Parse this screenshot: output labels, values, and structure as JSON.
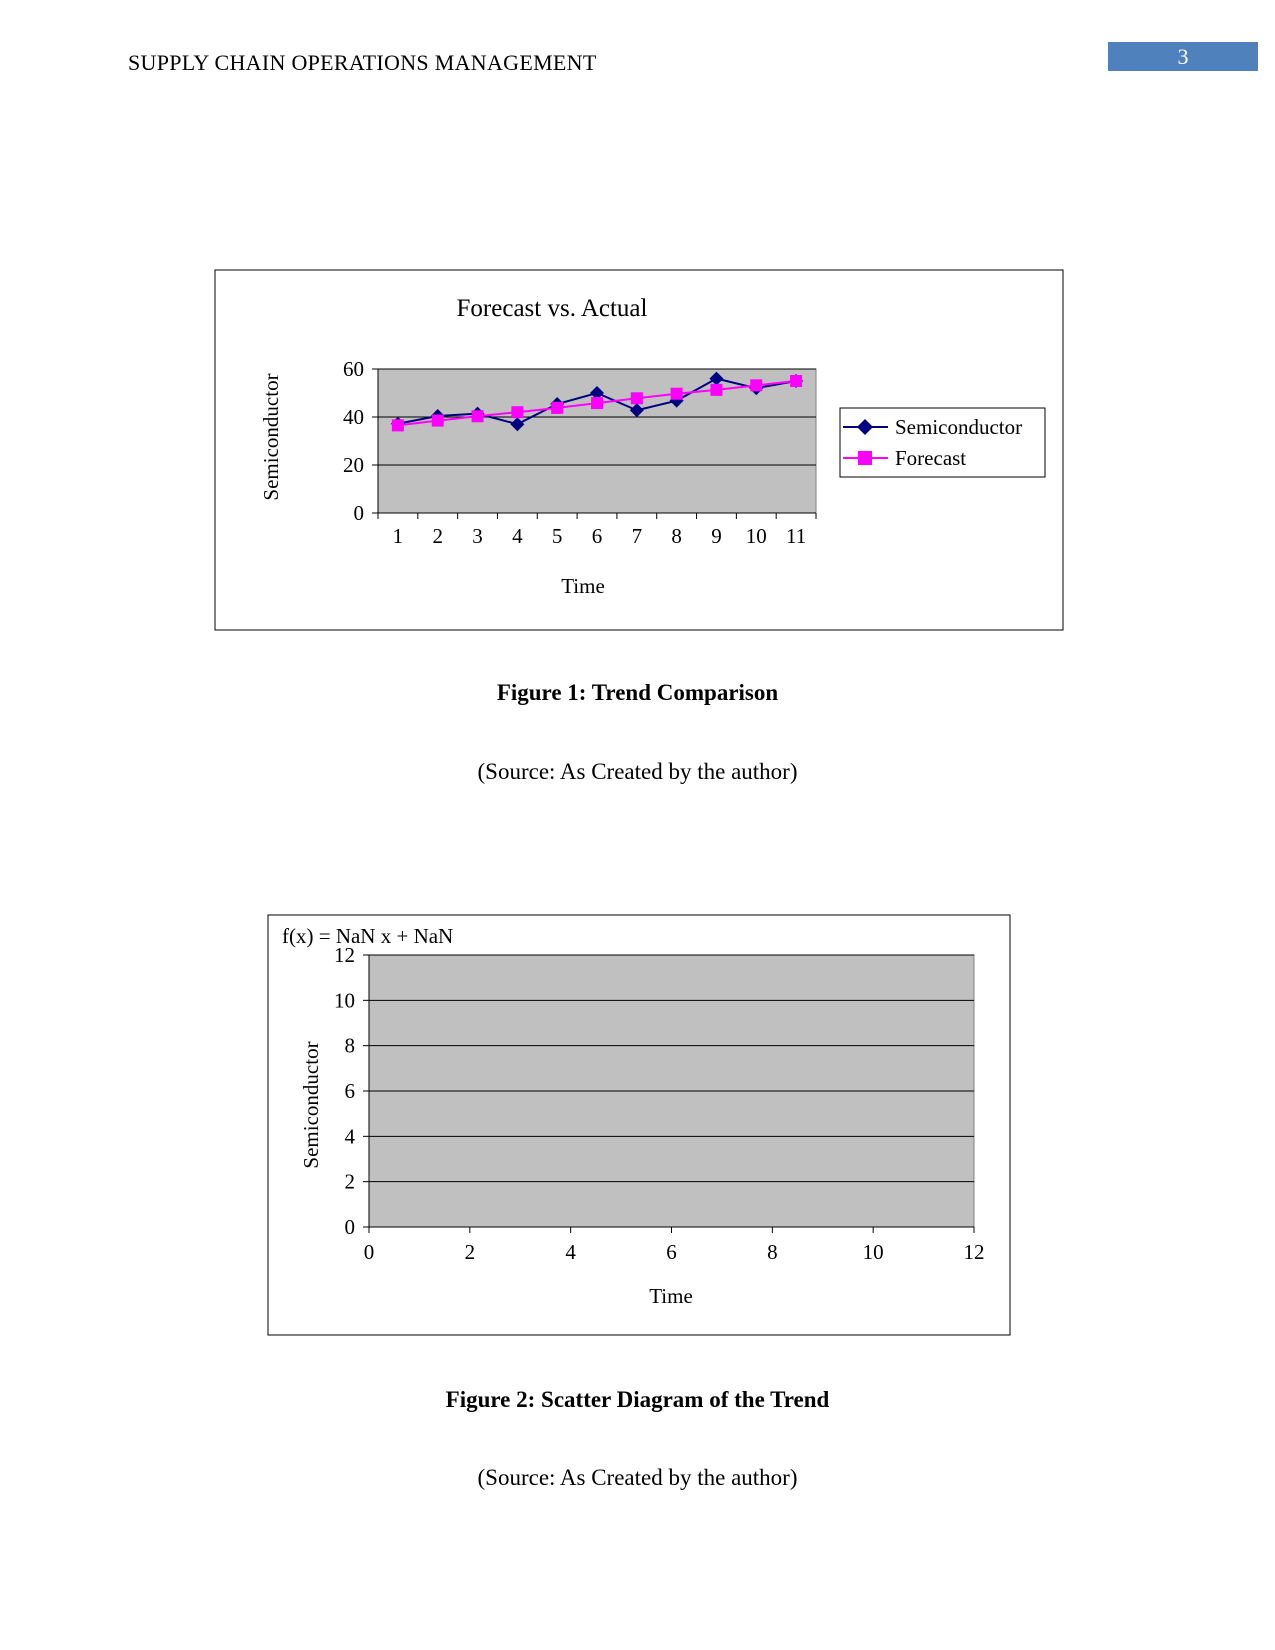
{
  "header": {
    "running_title": "SUPPLY CHAIN OPERATIONS MANAGEMENT",
    "page_number": "3"
  },
  "figure1": {
    "caption": "Figure 1: Trend Comparison",
    "source": "(Source: As Created by the author)"
  },
  "figure2": {
    "caption": "Figure 2: Scatter Diagram of the Trend",
    "source": "(Source: As Created by the author)"
  },
  "chart_data": [
    {
      "type": "line",
      "title": "Forecast vs. Actual",
      "xlabel": "Time",
      "ylabel": "Semiconductor",
      "categories": [
        "1",
        "2",
        "3",
        "4",
        "5",
        "6",
        "7",
        "8",
        "9",
        "10",
        "11"
      ],
      "ylim": [
        0,
        60
      ],
      "yticks": [
        "0",
        "20",
        "40",
        "60"
      ],
      "grid": true,
      "legend": "right",
      "plot_background": "#c0c0c0",
      "series": [
        {
          "name": "Semiconductor",
          "color": "#000080",
          "marker": "diamond",
          "values": [
            37.2,
            40.4,
            41.4,
            37,
            45.4,
            50,
            42.8,
            46.8,
            56,
            52,
            55
          ]
        },
        {
          "name": "Forecast",
          "color": "#ff00ff",
          "marker": "square",
          "values": [
            36.5,
            38.5,
            40.3,
            42,
            43.8,
            45.8,
            47.8,
            49.7,
            51.3,
            53.2,
            55
          ]
        }
      ]
    },
    {
      "type": "scatter",
      "title": "",
      "annotation": "f(x) = NaN x + NaN",
      "xlabel": "Time",
      "ylabel": "Semiconductor",
      "xlim": [
        0,
        12
      ],
      "ylim": [
        0,
        12
      ],
      "xticks": [
        "0",
        "2",
        "4",
        "6",
        "8",
        "10",
        "12"
      ],
      "yticks": [
        "0",
        "2",
        "4",
        "6",
        "8",
        "10",
        "12"
      ],
      "grid": true,
      "plot_background": "#c0c0c0",
      "series": []
    }
  ]
}
